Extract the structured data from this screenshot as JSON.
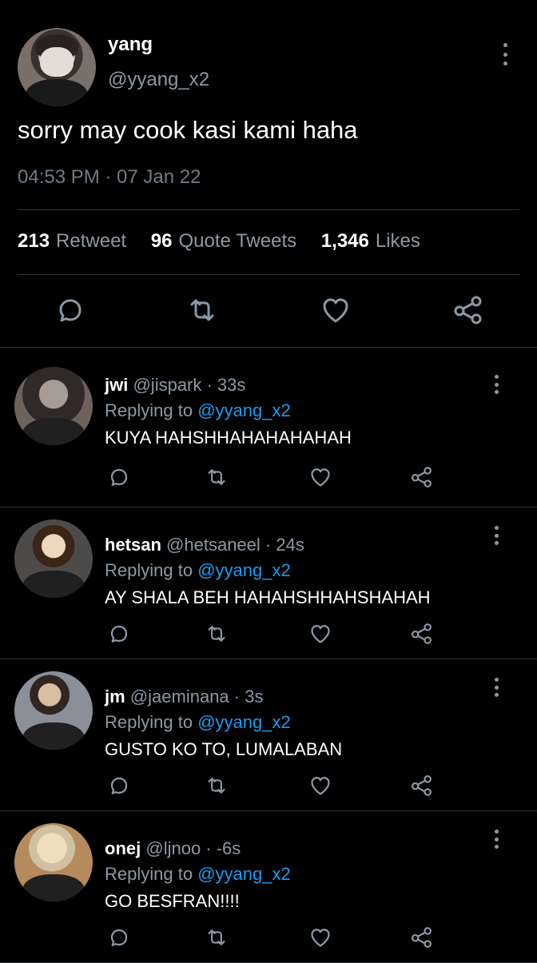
{
  "main_tweet": {
    "display_name": "yang",
    "handle": "@yyang_x2",
    "text": "sorry may cook kasi kami haha",
    "timestamp": "04:53 PM · 07 Jan 22",
    "stats": [
      {
        "count": "213",
        "label": "Retweet"
      },
      {
        "count": "96",
        "label": "Quote Tweets"
      },
      {
        "count": "1,346",
        "label": "Likes"
      }
    ]
  },
  "replies": [
    {
      "display_name": "jwi",
      "meta": "@jispark · 33s",
      "replying_prefix": "Replying to",
      "mention": "@yyang_x2",
      "text": "KUYA HAHSHHAHAHAHAHAH"
    },
    {
      "display_name": "hetsan",
      "meta": "@hetsaneel · 24s",
      "replying_prefix": "Replying to",
      "mention": "@yyang_x2",
      "text": "AY SHALA BEH HAHAHSHHAHSHAHAH"
    },
    {
      "display_name": "jm",
      "meta": "@jaeminana · 3s",
      "replying_prefix": "Replying to",
      "mention": "@yyang_x2",
      "text": "GUSTO KO TO, LUMALABAN"
    },
    {
      "display_name": "onej",
      "meta": "@ljnoo · -6s",
      "replying_prefix": "Replying to",
      "mention": "@yyang_x2",
      "text": "GO BESFRAN!!!!"
    }
  ],
  "icons": [
    "reply-icon",
    "retweet-icon",
    "like-icon",
    "share-icon",
    "more-icon"
  ],
  "colors": {
    "background": "#000000",
    "text": "#e7e9ea",
    "secondary": "#8b98a5",
    "link": "#1d9bf0",
    "divider": "#2f3336"
  }
}
